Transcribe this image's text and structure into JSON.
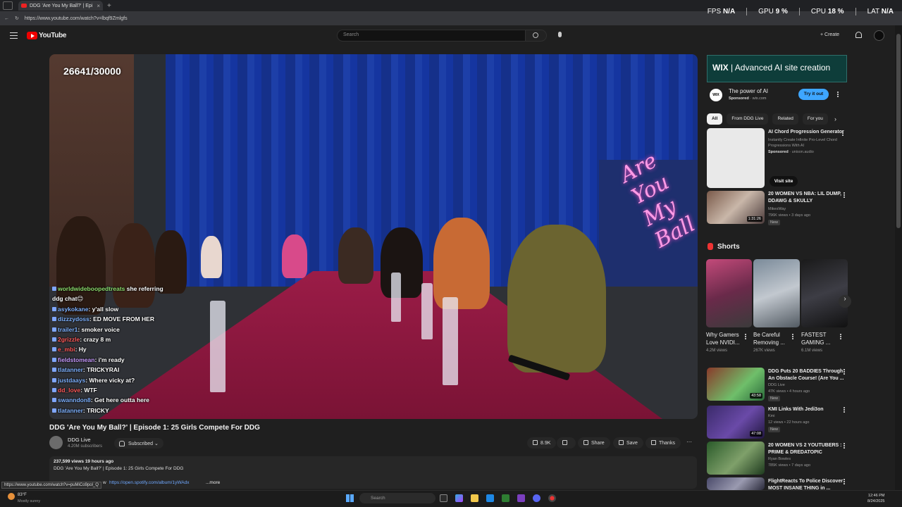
{
  "browser": {
    "tab_title": "DDG 'Are You My Ball?' | Epi",
    "tab_close": "×",
    "new_tab": "+",
    "url": "https://www.youtube.com/watch?v=lbqf9Zmlgfs",
    "status_url": "https://www.youtube.com/watch?v=puMiCo9pol_Q"
  },
  "perf_overlay": {
    "fps_label": "FPS",
    "fps_value": "N/A",
    "gpu_label": "GPU",
    "gpu_value": "9 %",
    "cpu_label": "CPU",
    "cpu_value": "18 %",
    "lat_label": "LAT",
    "lat_value": "N/A"
  },
  "header": {
    "logo_text": "YouTube",
    "search_placeholder": "Search",
    "create_label": "+ Create"
  },
  "player": {
    "counter": "26641/30000",
    "neon_sign": "Are You My Ball",
    "chat": [
      {
        "user": "worldwideboopedtreats",
        "msg": " she referring",
        "color": "g"
      },
      {
        "user": "",
        "msg": "ddg chat😊",
        "color": ""
      },
      {
        "user": "asykokane",
        "msg": ": y'all slow",
        "color": ""
      },
      {
        "user": "dizzzydoss",
        "msg": ": ED MOVE FROM HER",
        "color": ""
      },
      {
        "user": "trailer1",
        "msg": ": smoker voice",
        "color": ""
      },
      {
        "user": "2grizzle",
        "msg": ": crazy 8 m",
        "color": "r"
      },
      {
        "user": "e_mbi",
        "msg": ": Hy",
        "color": "r"
      },
      {
        "user": "fieldstomean",
        "msg": ": i'm ready",
        "color": "p"
      },
      {
        "user": "tlatanner",
        "msg": ": TRICKYRAI",
        "color": ""
      },
      {
        "user": "justdaays",
        "msg": ": Where vicky at?",
        "color": ""
      },
      {
        "user": "dd_love",
        "msg": ": WTF",
        "color": "r"
      },
      {
        "user": "swanndon8",
        "msg": ": Get here outta here",
        "color": ""
      },
      {
        "user": "tlatanner",
        "msg": ": TRICKY",
        "color": ""
      }
    ]
  },
  "video": {
    "title": "DDG 'Are You My Ball?' | Episode 1: 25 Girls Compete For DDG",
    "channel_name": "DDG Live",
    "channel_subs": "4.20M subscribers",
    "subscribed_label": "Subscribed",
    "like_count": "8.9K",
    "share_label": "Share",
    "save_label": "Save",
    "thanks_label": "Thanks",
    "more_actions": "···",
    "stats": "237,599 views  19 hours ago",
    "description": "DDG 'Are You My Ball?' | Episode 1: 25 Girls Compete For DDG",
    "desc_prefix": "w",
    "desc_link": "https://open.spotify.com/album/1yWAdx",
    "desc_more": "...more"
  },
  "sidebar": {
    "ad_banner_brand": "WIX",
    "ad_banner_text": "| Advanced AI site creation",
    "ad_logo": "WIX",
    "ad_title": "The power of AI",
    "ad_sponsored": "Sponsored",
    "ad_domain": " · wix.com",
    "ad_button": "Try it out",
    "chips": [
      "All",
      "From DDG Live",
      "Related",
      "For you"
    ],
    "chips_arrow": "›",
    "promoted": {
      "title": "AI Chord Progression Generator",
      "desc": "Instantly Create Infinite Pro-Level Chord Progressions With AI",
      "sponsored": "Sponsored",
      "domain": " · unison.audio",
      "visit_label": "Visit site"
    },
    "videos_top": [
      {
        "title": "20 WOMEN VS NBA: LIL DUMP, DDAWG & SKULLY",
        "channel": "MikesWay",
        "meta": "796K views • 3 days ago",
        "badge": "New",
        "duration": "1:31:26"
      }
    ],
    "shorts_label": "Shorts",
    "shorts_next": "›",
    "shorts": [
      {
        "title": "Why Gamers Love NVIDI...",
        "views": "4.2M views"
      },
      {
        "title": "Be Careful Removing ...",
        "views": "267K views"
      },
      {
        "title": "FASTEST GAMING ...",
        "views": "6.1M views"
      }
    ],
    "videos_bottom": [
      {
        "title": "DDG Puts 20 BADDIES Through An Obstacle Course! (Are You ...",
        "channel": "DDG Live",
        "meta": "47K views • 4 hours ago",
        "badge": "New",
        "duration": "43:58"
      },
      {
        "title": "KMI Links With Jedi3on",
        "channel": "Kmi",
        "meta": "12 views • 22 hours ago",
        "badge": "New",
        "duration": "47:08"
      },
      {
        "title": "20 WOMEN VS 2 YOUTUBERS : PRIME & DREDATOPIC",
        "channel": "Ryan Bowles",
        "meta": "785K views • 7 days ago",
        "badge": "",
        "duration": ""
      },
      {
        "title": "FlightReacts To Police Discover MOST INSANE THING in ...",
        "channel": "",
        "meta": "",
        "badge": "",
        "duration": ""
      }
    ]
  },
  "taskbar": {
    "weather_temp": "83°F",
    "weather_desc": "Mostly sunny",
    "search_placeholder": "Search",
    "time": "12:46 PM",
    "date": "8/24/2025"
  }
}
